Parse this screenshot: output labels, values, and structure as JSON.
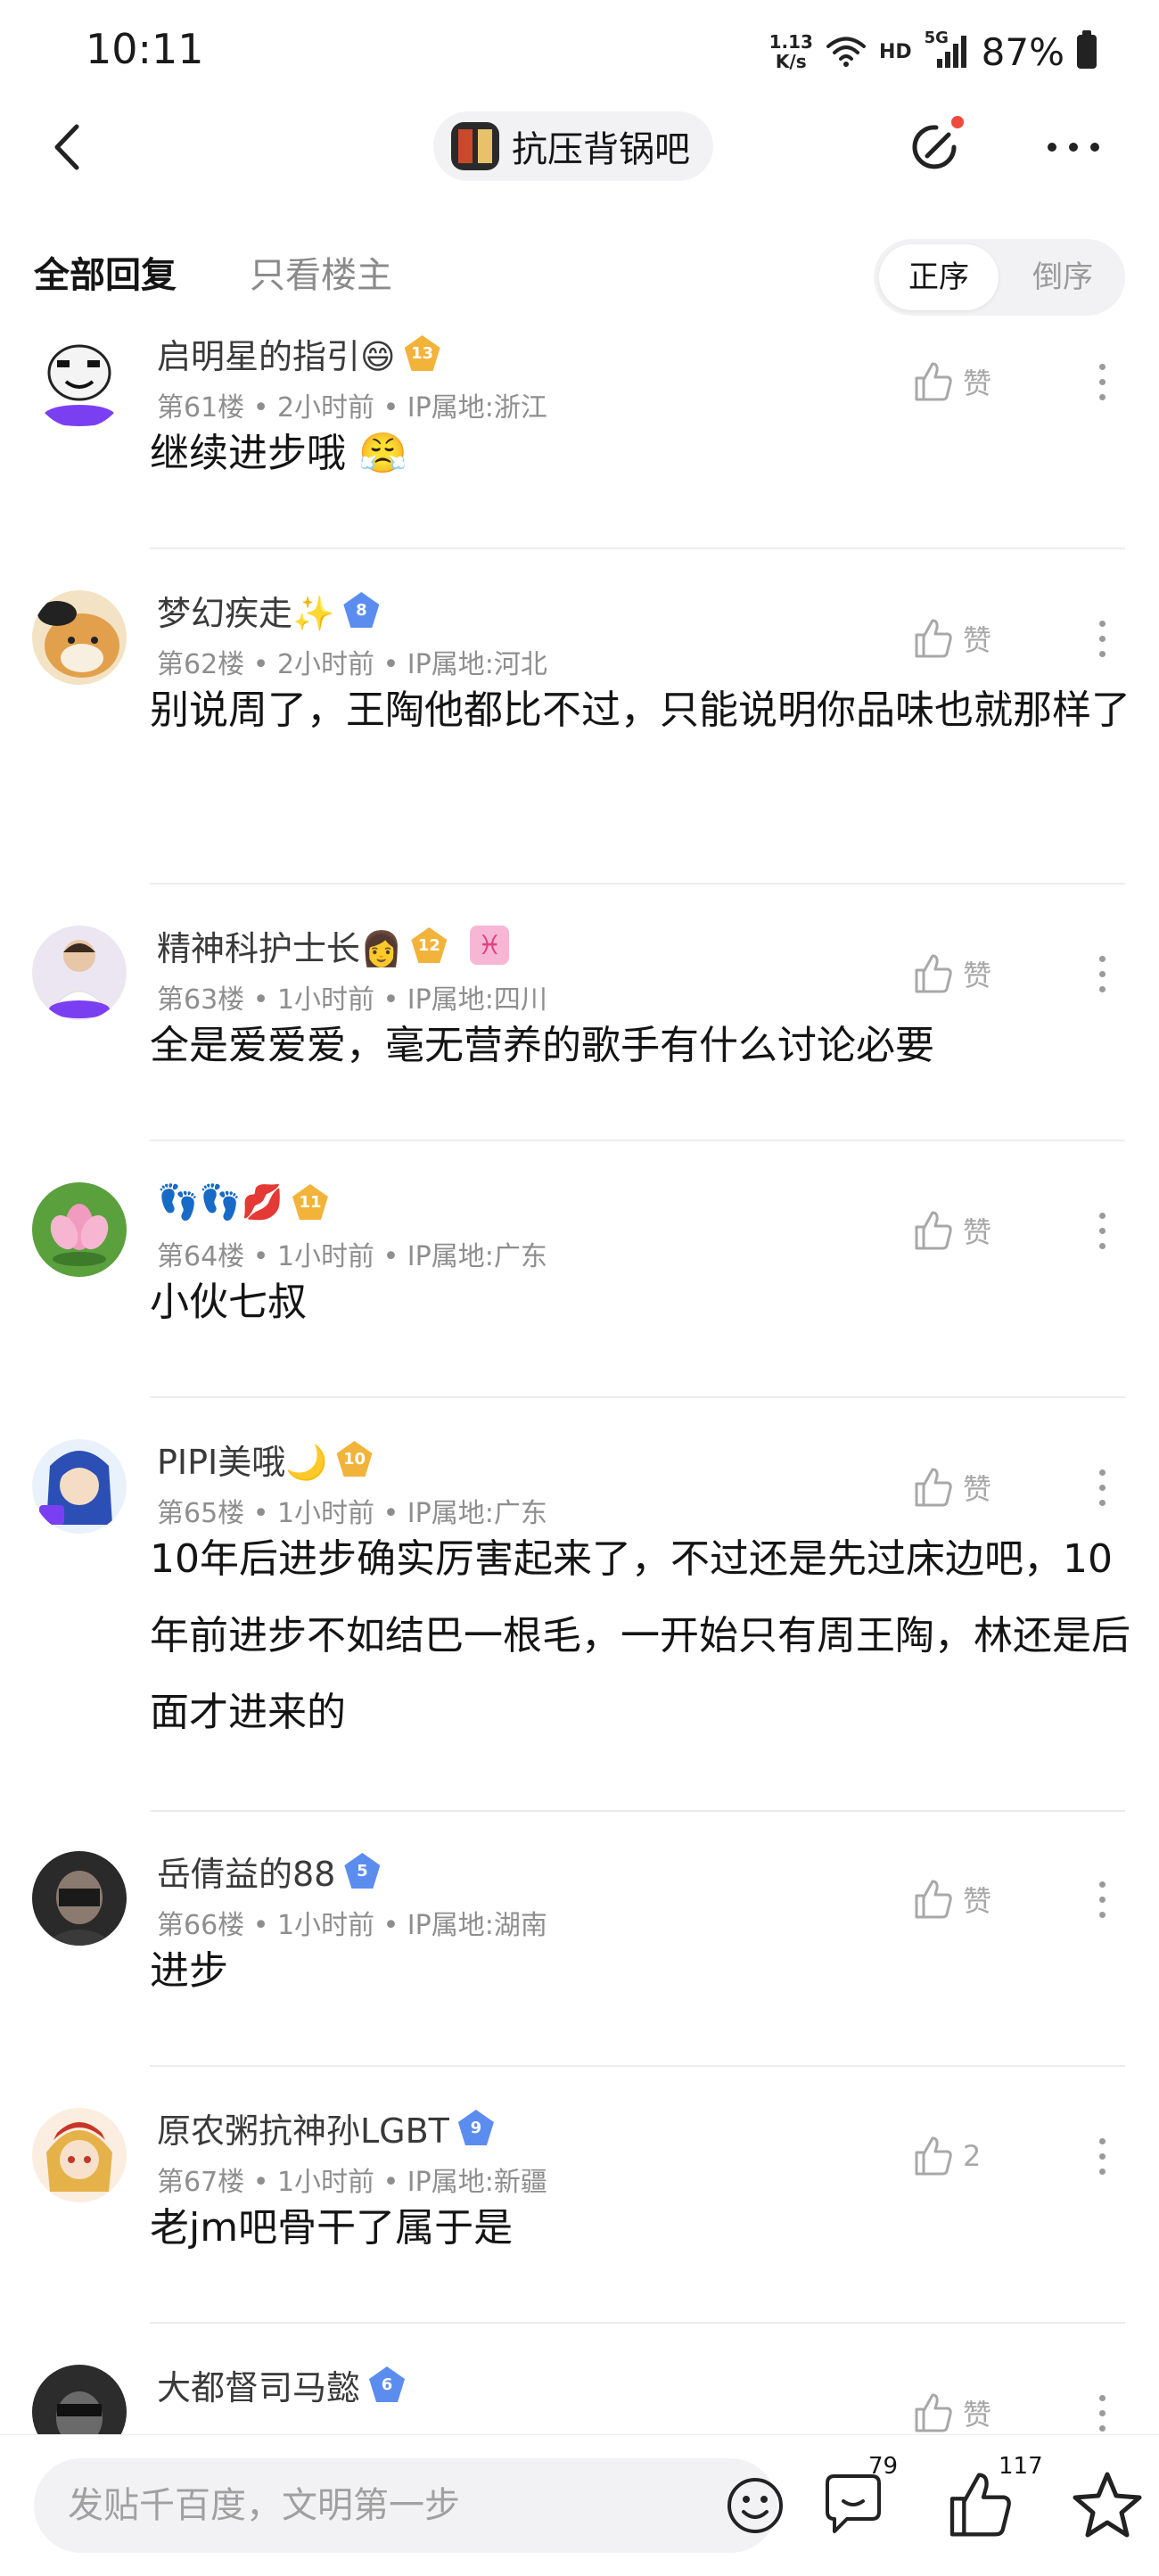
{
  "status_bar": {
    "time": "10:11",
    "net_speed_value": "1.13",
    "net_speed_unit": "K/s",
    "hd": "HD",
    "network": "5G",
    "battery": "87%"
  },
  "nav": {
    "forum_name": "抗压背锅吧"
  },
  "tabs": {
    "all_replies": "全部回复",
    "op_only": "只看楼主",
    "order_asc": "正序",
    "order_desc": "倒序"
  },
  "comments": [
    {
      "username": "启明星的指引😄",
      "level": "13",
      "meta": "第61楼 • 2小时前 • IP属地:浙江",
      "like": "赞",
      "content": "继续进步哦 😤"
    },
    {
      "username": "梦幻疾走✨",
      "level": "8",
      "meta": "第62楼 • 2小时前 • IP属地:河北",
      "like": "赞",
      "content": "别说周了，王陶他都比不过，只能说明你品味也就那样了"
    },
    {
      "username": "精神科护士长👩",
      "level": "12",
      "zodiac": "♓",
      "meta": "第63楼 • 1小时前 • IP属地:四川",
      "like": "赞",
      "content": "全是爱爱爱，毫无营养的歌手有什么讨论必要"
    },
    {
      "username": "👣👣💋",
      "level": "11",
      "meta": "第64楼 • 1小时前 • IP属地:广东",
      "like": "赞",
      "content": "小伙七叔"
    },
    {
      "username": "PIPI美哦🌙",
      "level": "10",
      "meta": "第65楼 • 1小时前 • IP属地:广东",
      "like": "赞",
      "content": "10年后进步确实厉害起来了，不过还是先过床边吧，10年前进步不如结巴一根毛，一开始只有周王陶，林还是后面才进来的"
    },
    {
      "username": "岳倩益的88",
      "level": "5",
      "meta": "第66楼 • 1小时前 • IP属地:湖南",
      "like": "赞",
      "content": "进步"
    },
    {
      "username": "原农粥抗神孙LGBT",
      "level": "9",
      "meta": "第67楼 • 1小时前 • IP属地:新疆",
      "like": "2",
      "content": "老jm吧骨干了属于是"
    },
    {
      "username": "大都督司马懿",
      "level": "6",
      "like": "赞"
    }
  ],
  "bottom_bar": {
    "input_placeholder": "发贴千百度，文明第一步",
    "comment_count": "79",
    "like_count": "117"
  },
  "colors": {
    "accent_red": "#f04a3e",
    "level_blue": "#5b8def",
    "level_gold": "#f2b33a",
    "meta_gray": "#8e8e8e"
  }
}
